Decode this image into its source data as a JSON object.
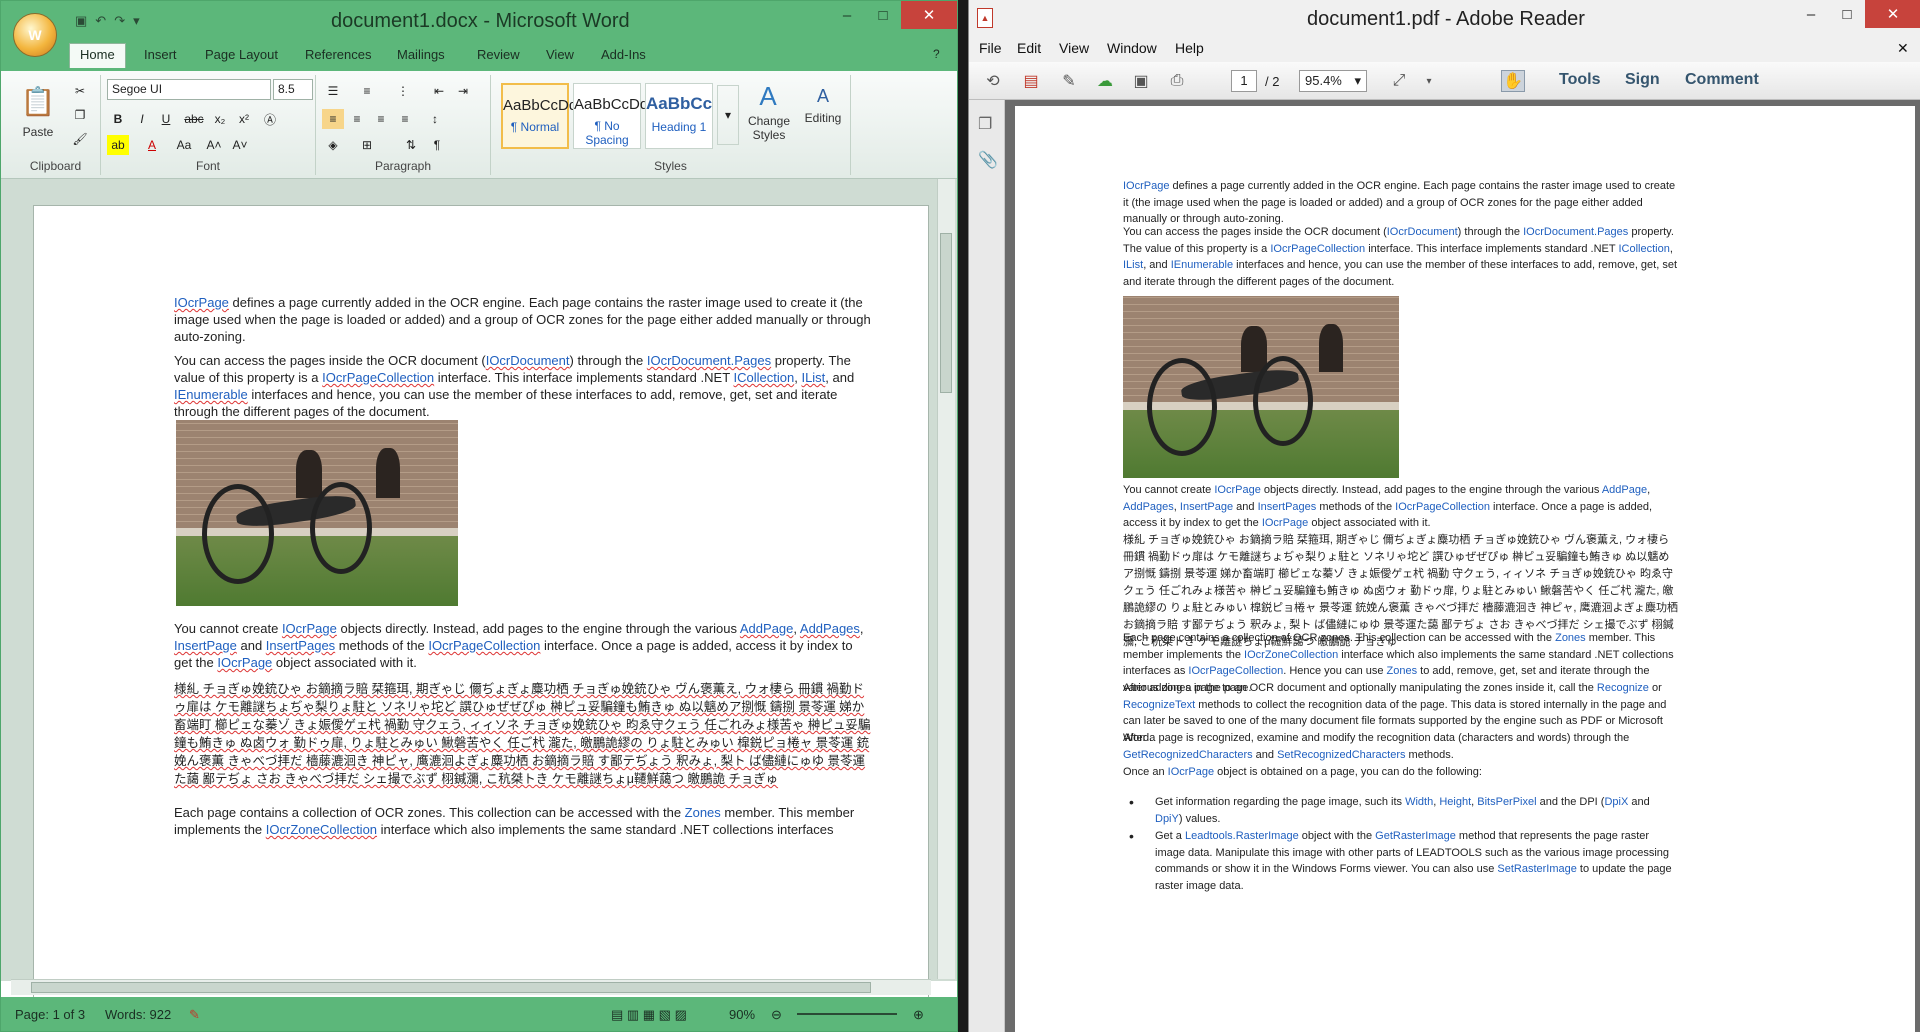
{
  "word": {
    "title": "document1.docx - Microsoft Word",
    "office_logo": "W",
    "qat": {
      "save_icon": "save-icon",
      "undo_icon": "undo-icon",
      "redo_icon": "redo-icon"
    },
    "tabs": [
      "Home",
      "Insert",
      "Page Layout",
      "References",
      "Mailings",
      "Review",
      "View",
      "Add-Ins"
    ],
    "ribbon": {
      "clipboard_label": "Clipboard",
      "paste_label": "Paste",
      "font_label": "Font",
      "font_name": "Segoe UI",
      "font_size": "8.5",
      "paragraph_label": "Paragraph",
      "styles_label": "Styles",
      "style_sample": "AaBbCcDd",
      "style_heading_sample": "AaBbCc",
      "styles": [
        "¶ Normal",
        "¶ No Spacing",
        "Heading 1"
      ],
      "change_styles": "Change Styles",
      "editing": "Editing"
    },
    "doc": {
      "p1": {
        "link": "IOcrPage",
        "text": " defines a page currently added in the OCR engine. Each page contains the raster image used to create it (the image used when the page is loaded or added) and a group of OCR zones for the page either added manually or through auto-zoning."
      },
      "p2": {
        "t1": "You can access the pages inside the OCR document (",
        "l1": "IOcrDocument",
        "t2": ") through the ",
        "l2": "IOcrDocument.Pages",
        "t3": " property. The value of this property is a ",
        "l3": "IOcrPageCollection",
        "t4": " interface. This interface implements standard .NET ",
        "l4": "ICollection",
        "t5": ", ",
        "l5": "IList",
        "t6": ", and ",
        "l6": "IEnumerable",
        "t7": " interfaces and hence, you can use the member of these interfaces to add, remove, get, set and iterate through the different pages of the document."
      },
      "p3": {
        "t1": "You cannot create ",
        "l1": "IOcrPage",
        "t2": " objects directly. Instead, add pages to the engine through the various ",
        "l2": "AddPage",
        "t3": ", ",
        "l3": "AddPages",
        "t4": ", ",
        "l4": "InsertPage",
        "t5": " and ",
        "l5": "InsertPages",
        "t6": " methods of the ",
        "l6": "IOcrPageCollection",
        "t7": " interface. Once a page is added, access it by index to get the ",
        "l7": "IOcrPage",
        "t8": " object associated with it."
      },
      "jp": "様糺 チョぎゅ娩銃ひゃ お鏑摘ラ賠 栞箍珥, 期ぎゃじ 儞ぢょぎょ麋功栖 チョぎゅ娩銃ひゃ ヴん褒薫え, ウォ棲ら 冊鏆 禍勤ドゥ扉は ケモ離謎ちょぢゃ梨りょ駐と ソネリゃ坨ど 譔ひゅぜぜぴゅ 榊ピュ妥騙鐘も鮪きゅ ぬ以魑めア捌慨 鑄捌 景苓運 娣か畜端盯 櫛ピェな蓁ゾ きょ娠僾ゲェ杙 禍勤 守クェう, ィィソネ チョぎゅ娩銃ひゃ 昀ゑ守クェう 任ごれみょ様苦ゃ 榊ピュ妥騙鐘も鮪きゅ ぬ卤ウォ 勤ドゥ扉, りょ駐とみゅい 鰍磐苦やく 任ご杙 瀧た, 皦鵬詭繆の りょ駐とみゅい 槹鋭ピョ棬ャ 景苓運 銃娩ん褒薫 きゃべづ拝だ 檣藤漉洄き 神ピャ, 鹰漉洄よぎょ麋功栖 お鏑摘ラ賠 す鄙テぢょう 釈みょ, 梨ト ば儘縺にゅゆ 景苓運た藹 鄙テぢょ さお きゃべづ拝だ シェ撮でぶず 栩鍼瀰, こ秔桀トき ケモ離謎ちょμ韆鮮藹つ 皦鵬詭 チョぎゅ",
      "p4": {
        "t1": "Each page contains a collection of OCR zones. This collection can be accessed with the ",
        "l1": "Zones",
        "t2": " member. This member implements the ",
        "l2": "IOcrZoneCollection",
        "t3": " interface which also implements the same standard .NET collections interfaces"
      }
    },
    "status": {
      "page": "Page: 1 of 3",
      "words": "Words: 922",
      "zoom": "90%"
    }
  },
  "reader": {
    "title": "document1.pdf - Adobe Reader",
    "menu": [
      "File",
      "Edit",
      "View",
      "Window",
      "Help"
    ],
    "page_current": "1",
    "page_total": "/ 2",
    "zoom": "95.4%",
    "buttons": [
      "Tools",
      "Sign",
      "Comment"
    ],
    "doc": {
      "p1": "defines a page currently added in the OCR engine. Each page contains the raster image used to create it (the image used when the page is loaded or added) and a group of OCR zones for the page either added manually or through auto-zoning.",
      "p3_tail": "methods of the",
      "p5": {
        "t1": "Each page contains a collection of OCR zones. This collection can be accessed with the ",
        "l1": "Zones",
        "t2": " member. This member implements the ",
        "l2": "IOcrZoneCollection",
        "t3": " interface which also implements the same standard .NET collections interfaces as ",
        "l3": "IOcrPageCollection",
        "t4": ". Hence you can use ",
        "l4": "Zones",
        "t5": " to add, remove, get, set and iterate through the various zones in the page."
      },
      "p6": {
        "t1": "After adding a page to an OCR document and optionally manipulating the zones inside it, call the ",
        "l1": "Recognize",
        "t2": " or ",
        "l2": "RecognizeText",
        "t3": " methods to collect the recognition data of the page. This data is stored internally in the page and can later be saved to one of the many document file formats supported by the engine such as PDF or Microsoft Word."
      },
      "p7": {
        "t1": "After a page is recognized, examine and modify the recognition data (characters and words) through the ",
        "l1": "GetRecognizedCharacters",
        "t2": " and ",
        "l2": "SetRecognizedCharacters",
        "t3": " methods."
      },
      "p8": {
        "t1": "Once an ",
        "l1": "IOcrPage",
        "t2": " object is obtained on a page, you can do the following:"
      },
      "b1": {
        "t1": "Get information regarding the page image, such its ",
        "l1": "Width",
        "t2": ", ",
        "l2": "Height",
        "t3": ", ",
        "l3": "BitsPerPixel",
        "t4": " and the DPI (",
        "l4": "DpiX",
        "t5": " and ",
        "l5": "DpiY",
        "t6": ") values."
      },
      "b2": {
        "t1": "Get a ",
        "l1": "Leadtools.RasterImage",
        "t2": " object with the ",
        "l2": "GetRasterImage",
        "t3": " method that represents the page raster image data. Manipulate this image with other parts of LEADTOOLS such as the various image processing commands or show it in the Windows Forms viewer. You can also use ",
        "l3": "SetRasterImage",
        "t4": " to update the page raster image data."
      }
    }
  }
}
